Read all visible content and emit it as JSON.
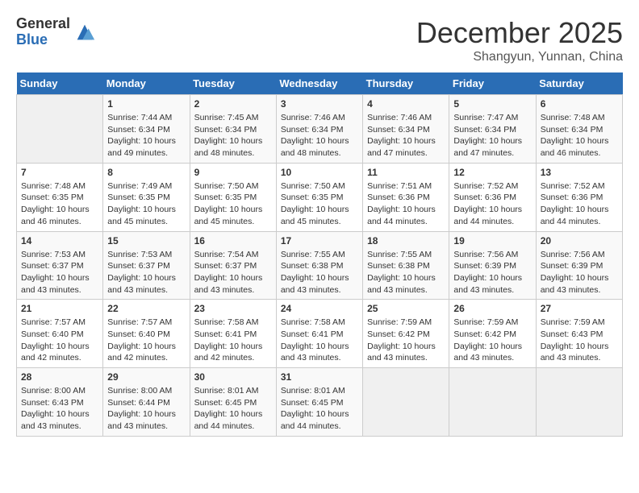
{
  "header": {
    "logo_general": "General",
    "logo_blue": "Blue",
    "month_title": "December 2025",
    "location": "Shangyun, Yunnan, China"
  },
  "days_of_week": [
    "Sunday",
    "Monday",
    "Tuesday",
    "Wednesday",
    "Thursday",
    "Friday",
    "Saturday"
  ],
  "weeks": [
    [
      {
        "day": "",
        "info": ""
      },
      {
        "day": "1",
        "info": "Sunrise: 7:44 AM\nSunset: 6:34 PM\nDaylight: 10 hours and 49 minutes."
      },
      {
        "day": "2",
        "info": "Sunrise: 7:45 AM\nSunset: 6:34 PM\nDaylight: 10 hours and 48 minutes."
      },
      {
        "day": "3",
        "info": "Sunrise: 7:46 AM\nSunset: 6:34 PM\nDaylight: 10 hours and 48 minutes."
      },
      {
        "day": "4",
        "info": "Sunrise: 7:46 AM\nSunset: 6:34 PM\nDaylight: 10 hours and 47 minutes."
      },
      {
        "day": "5",
        "info": "Sunrise: 7:47 AM\nSunset: 6:34 PM\nDaylight: 10 hours and 47 minutes."
      },
      {
        "day": "6",
        "info": "Sunrise: 7:48 AM\nSunset: 6:34 PM\nDaylight: 10 hours and 46 minutes."
      }
    ],
    [
      {
        "day": "7",
        "info": "Sunrise: 7:48 AM\nSunset: 6:35 PM\nDaylight: 10 hours and 46 minutes."
      },
      {
        "day": "8",
        "info": "Sunrise: 7:49 AM\nSunset: 6:35 PM\nDaylight: 10 hours and 45 minutes."
      },
      {
        "day": "9",
        "info": "Sunrise: 7:50 AM\nSunset: 6:35 PM\nDaylight: 10 hours and 45 minutes."
      },
      {
        "day": "10",
        "info": "Sunrise: 7:50 AM\nSunset: 6:35 PM\nDaylight: 10 hours and 45 minutes."
      },
      {
        "day": "11",
        "info": "Sunrise: 7:51 AM\nSunset: 6:36 PM\nDaylight: 10 hours and 44 minutes."
      },
      {
        "day": "12",
        "info": "Sunrise: 7:52 AM\nSunset: 6:36 PM\nDaylight: 10 hours and 44 minutes."
      },
      {
        "day": "13",
        "info": "Sunrise: 7:52 AM\nSunset: 6:36 PM\nDaylight: 10 hours and 44 minutes."
      }
    ],
    [
      {
        "day": "14",
        "info": "Sunrise: 7:53 AM\nSunset: 6:37 PM\nDaylight: 10 hours and 43 minutes."
      },
      {
        "day": "15",
        "info": "Sunrise: 7:53 AM\nSunset: 6:37 PM\nDaylight: 10 hours and 43 minutes."
      },
      {
        "day": "16",
        "info": "Sunrise: 7:54 AM\nSunset: 6:37 PM\nDaylight: 10 hours and 43 minutes."
      },
      {
        "day": "17",
        "info": "Sunrise: 7:55 AM\nSunset: 6:38 PM\nDaylight: 10 hours and 43 minutes."
      },
      {
        "day": "18",
        "info": "Sunrise: 7:55 AM\nSunset: 6:38 PM\nDaylight: 10 hours and 43 minutes."
      },
      {
        "day": "19",
        "info": "Sunrise: 7:56 AM\nSunset: 6:39 PM\nDaylight: 10 hours and 43 minutes."
      },
      {
        "day": "20",
        "info": "Sunrise: 7:56 AM\nSunset: 6:39 PM\nDaylight: 10 hours and 43 minutes."
      }
    ],
    [
      {
        "day": "21",
        "info": "Sunrise: 7:57 AM\nSunset: 6:40 PM\nDaylight: 10 hours and 42 minutes."
      },
      {
        "day": "22",
        "info": "Sunrise: 7:57 AM\nSunset: 6:40 PM\nDaylight: 10 hours and 42 minutes."
      },
      {
        "day": "23",
        "info": "Sunrise: 7:58 AM\nSunset: 6:41 PM\nDaylight: 10 hours and 42 minutes."
      },
      {
        "day": "24",
        "info": "Sunrise: 7:58 AM\nSunset: 6:41 PM\nDaylight: 10 hours and 43 minutes."
      },
      {
        "day": "25",
        "info": "Sunrise: 7:59 AM\nSunset: 6:42 PM\nDaylight: 10 hours and 43 minutes."
      },
      {
        "day": "26",
        "info": "Sunrise: 7:59 AM\nSunset: 6:42 PM\nDaylight: 10 hours and 43 minutes."
      },
      {
        "day": "27",
        "info": "Sunrise: 7:59 AM\nSunset: 6:43 PM\nDaylight: 10 hours and 43 minutes."
      }
    ],
    [
      {
        "day": "28",
        "info": "Sunrise: 8:00 AM\nSunset: 6:43 PM\nDaylight: 10 hours and 43 minutes."
      },
      {
        "day": "29",
        "info": "Sunrise: 8:00 AM\nSunset: 6:44 PM\nDaylight: 10 hours and 43 minutes."
      },
      {
        "day": "30",
        "info": "Sunrise: 8:01 AM\nSunset: 6:45 PM\nDaylight: 10 hours and 44 minutes."
      },
      {
        "day": "31",
        "info": "Sunrise: 8:01 AM\nSunset: 6:45 PM\nDaylight: 10 hours and 44 minutes."
      },
      {
        "day": "",
        "info": ""
      },
      {
        "day": "",
        "info": ""
      },
      {
        "day": "",
        "info": ""
      }
    ]
  ]
}
